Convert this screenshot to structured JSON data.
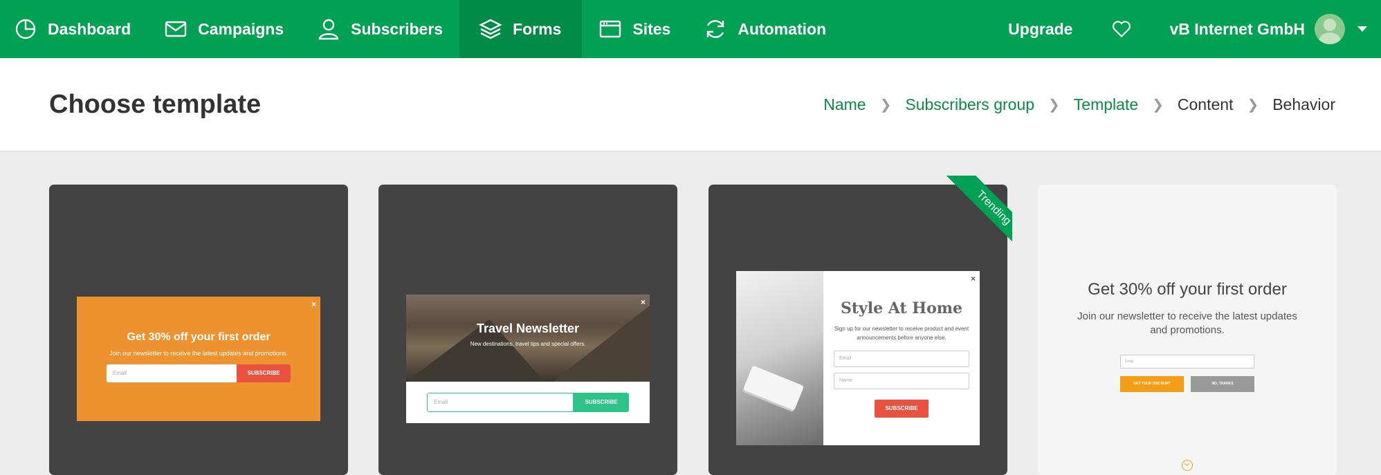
{
  "nav": {
    "items": [
      {
        "label": "Dashboard",
        "icon": "dashboard-icon"
      },
      {
        "label": "Campaigns",
        "icon": "mail-icon"
      },
      {
        "label": "Subscribers",
        "icon": "user-icon"
      },
      {
        "label": "Forms",
        "icon": "layers-icon",
        "active": true
      },
      {
        "label": "Sites",
        "icon": "browser-icon"
      },
      {
        "label": "Automation",
        "icon": "refresh-icon"
      }
    ],
    "upgrade": "Upgrade",
    "account": "vB Internet GmbH"
  },
  "header": {
    "title": "Choose template",
    "breadcrumb": [
      {
        "label": "Name",
        "done": true
      },
      {
        "label": "Subscribers group",
        "done": true
      },
      {
        "label": "Template",
        "done": true
      },
      {
        "label": "Content",
        "done": false
      },
      {
        "label": "Behavior",
        "done": false
      }
    ]
  },
  "templates": [
    {
      "title": "Get 30% off your first order",
      "subtitle": "Join our newsletter to receive the latest updates and promotions.",
      "email_placeholder": "Email",
      "button": "SUBSCRIBE",
      "close": "×"
    },
    {
      "title": "Travel Newsletter",
      "subtitle": "New destinations, travel tips and special offers.",
      "email_placeholder": "Email",
      "button": "SUBSCRIBE",
      "close": "×"
    },
    {
      "title": "Style At Home",
      "subtitle": "Sign up for our newsletter to receive product and event announcements before anyone else.",
      "email_placeholder": "Email",
      "name_placeholder": "Name",
      "button": "SUBSCRIBE",
      "close": "×",
      "badge": "Trending"
    },
    {
      "title": "Get 30% off your first order",
      "subtitle": "Join our newsletter to receive the latest updates and promotions.",
      "email_placeholder": "Email",
      "button_primary": "GET YOUR DISCOUNT",
      "button_secondary": "NO, THANKS"
    }
  ],
  "colors": {
    "brand": "#00a152",
    "card_dark": "#434343",
    "orange": "#ee9230",
    "red": "#e8523f",
    "teal": "#2ec489"
  }
}
